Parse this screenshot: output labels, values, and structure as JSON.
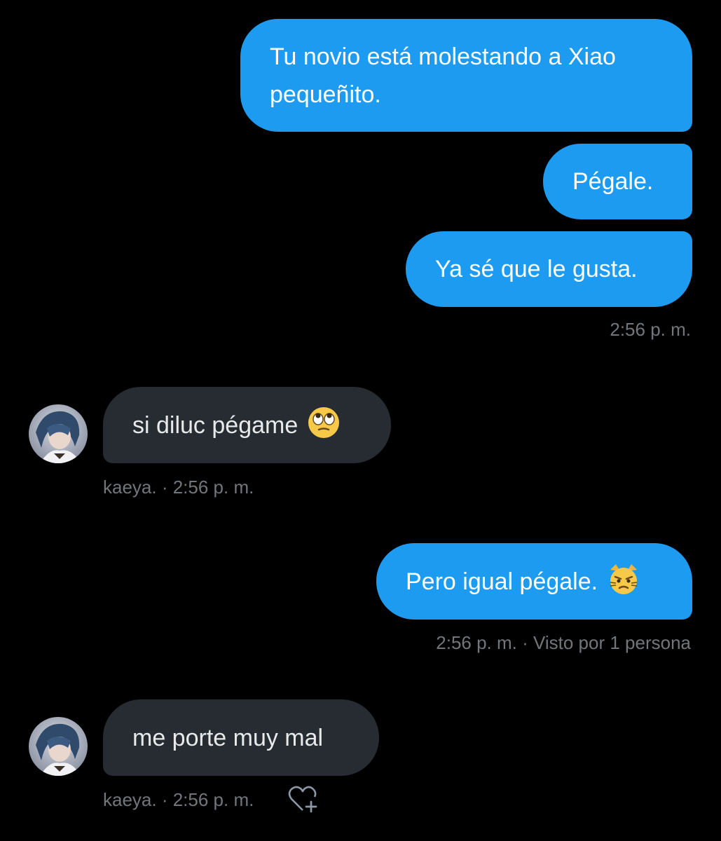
{
  "messages": {
    "m1_text": "Tu novio está molestando a Xiao pequeñito.",
    "m2_text": "Pégale.",
    "m3_text": "Ya sé que le gusta.",
    "m3_time": "2:56 p. m.",
    "m4_text": "si diluc pégame",
    "m4_emoji": "face-with-rolling-eyes-icon",
    "m4_meta": "kaeya. · 2:56 p. m.",
    "m5_text": "Pero igual pégale.",
    "m5_emoji": "pouting-cat-face-icon",
    "m5_meta": "2:56 p. m. · Visto por 1 persona",
    "m6_text": "me porte muy mal",
    "m6_meta": "kaeya. · 2:56 p. m."
  },
  "colors": {
    "background": "#000000",
    "outgoing_bubble": "#1d9bf0",
    "incoming_bubble": "#262c32",
    "meta_text": "#71767b"
  }
}
